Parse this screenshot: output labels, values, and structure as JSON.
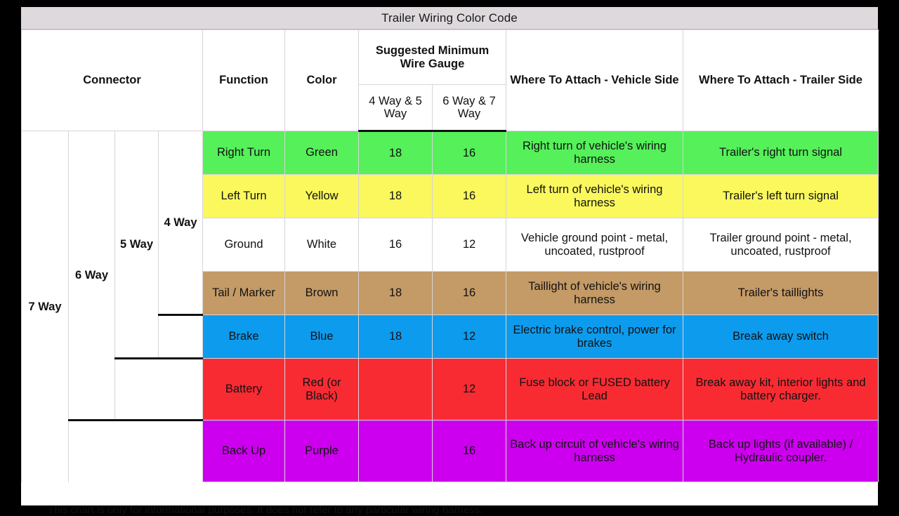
{
  "title": "Trailer Wiring Color Code",
  "colors": {
    "titlebar_bg": "#ded9dd",
    "green": "#55f05a",
    "yellow": "#faf85c",
    "white": "#ffffff",
    "brown": "#c49a66",
    "blue": "#0d9bee",
    "red": "#f82b33",
    "purple": "#cc00ee",
    "grid": "#d8d4d8",
    "rule": "#111111"
  },
  "headers": {
    "connector": "Connector",
    "function": "Function",
    "color": "Color",
    "gauge": "Suggested Minimum Wire Gauge",
    "gauge_sub_1": "4 Way & 5 Way",
    "gauge_sub_2": "6 Way & 7 Way",
    "attach_vehicle": "Where To Attach - Vehicle Side",
    "attach_trailer": "Where To Attach - Trailer Side"
  },
  "connectors": [
    {
      "label": "7 Way",
      "spans": 7
    },
    {
      "label": "6 Way",
      "spans": 6
    },
    {
      "label": "5 Way",
      "spans": 5
    },
    {
      "label": "4 Way",
      "spans": 4
    }
  ],
  "rows": [
    {
      "function": "Right Turn",
      "color": "Green",
      "gauge_45": "18",
      "gauge_67": "16",
      "vehicle": "Right turn of vehicle's wiring harness",
      "trailer": "Trailer's right turn signal",
      "bg": "#55f05a",
      "height": 62
    },
    {
      "function": "Left Turn",
      "color": "Yellow",
      "gauge_45": "18",
      "gauge_67": "16",
      "vehicle": "Left turn of vehicle's wiring harness",
      "trailer": "Trailer's left turn signal",
      "bg": "#faf85c",
      "height": 62
    },
    {
      "function": "Ground",
      "color": "White",
      "gauge_45": "16",
      "gauge_67": "12",
      "vehicle": "Vehicle ground point - metal, uncoated, rustproof",
      "trailer": "Trailer ground point - metal, uncoated, rustproof",
      "bg": "#ffffff",
      "height": 76
    },
    {
      "function": "Tail / Marker",
      "color": "Brown",
      "gauge_45": "18",
      "gauge_67": "16",
      "vehicle": "Taillight of vehicle's wiring harness",
      "trailer": "Trailer's taillights",
      "bg": "#c49a66",
      "height": 62
    },
    {
      "function": "Brake",
      "color": "Blue",
      "gauge_45": "18",
      "gauge_67": "12",
      "vehicle": "Electric brake control, power for brakes",
      "trailer": "Break away switch",
      "bg": "#0d9bee",
      "height": 62
    },
    {
      "function": "Battery",
      "color": "Red (or Black)",
      "gauge_45": "",
      "gauge_67": "12",
      "vehicle": "Fuse block or FUSED battery Lead",
      "trailer": "Break away kit, interior lights and battery charger.",
      "bg": "#f82b33",
      "height": 88
    },
    {
      "function": "Back Up",
      "color": "Purple",
      "gauge_45": "",
      "gauge_67": "16",
      "vehicle": "Back up circuit of vehicle's wiring harness",
      "trailer": "Back up lights (if available) / Hydraulic coupler.",
      "bg": "#cc00ee",
      "height": 88
    }
  ],
  "note": "This chart is only for informational purposes. It does not refer to any particular wiring harness."
}
